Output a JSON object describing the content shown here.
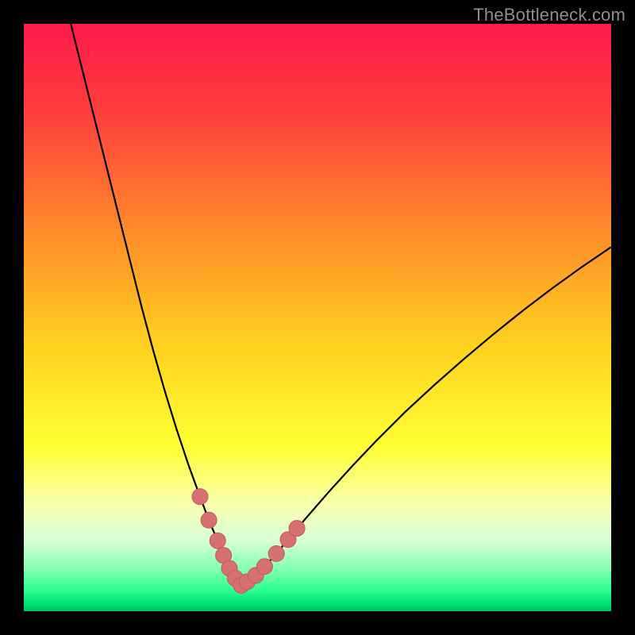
{
  "watermark": "TheBottleneck.com",
  "colors": {
    "frame": "#000000",
    "watermark": "#8f8f8f",
    "curve": "#000000",
    "marker_fill": "#d77070",
    "marker_stroke": "#c55a5a"
  },
  "chart_data": {
    "type": "line",
    "title": "",
    "xlabel": "",
    "ylabel": "",
    "xlim": [
      0,
      100
    ],
    "ylim": [
      0,
      100
    ],
    "gradient_stops": [
      {
        "offset": 0.0,
        "color": "#ff1a4b"
      },
      {
        "offset": 0.15,
        "color": "#ff3e3e"
      },
      {
        "offset": 0.35,
        "color": "#ff8a2a"
      },
      {
        "offset": 0.55,
        "color": "#ffd21f"
      },
      {
        "offset": 0.72,
        "color": "#ffff33"
      },
      {
        "offset": 0.82,
        "color": "#f7ffb0"
      },
      {
        "offset": 0.88,
        "color": "#d8ffd8"
      },
      {
        "offset": 0.93,
        "color": "#80ffb0"
      },
      {
        "offset": 0.965,
        "color": "#2bff8f"
      },
      {
        "offset": 0.985,
        "color": "#00e676"
      },
      {
        "offset": 1.0,
        "color": "#00c060"
      }
    ],
    "series": [
      {
        "name": "bottleneck-curve",
        "description": "V-shaped bottleneck/mismatch curve; two monotone branches meeting near x≈37",
        "x": [
          8,
          10,
          12,
          14,
          16,
          18,
          20,
          22,
          24,
          26,
          28,
          30,
          31.5,
          33,
          34,
          35,
          36,
          37,
          38,
          39.5,
          41,
          43,
          45,
          48,
          52,
          56,
          60,
          65,
          70,
          75,
          80,
          85,
          90,
          95,
          100
        ],
        "y": [
          100,
          92,
          84,
          76,
          68,
          60,
          52,
          44.5,
          37.5,
          31,
          25,
          19.5,
          15.5,
          12,
          9.5,
          7.3,
          5.6,
          4.4,
          5.0,
          6.1,
          7.6,
          9.8,
          12.2,
          15.8,
          20.4,
          24.8,
          29.0,
          34.0,
          38.6,
          43.0,
          47.2,
          51.2,
          55.0,
          58.6,
          62.0
        ]
      }
    ],
    "markers": {
      "name": "highlight-points",
      "description": "Clustered salmon markers near the valley/minimum of the curve",
      "points": [
        {
          "x": 30.0,
          "y": 19.5
        },
        {
          "x": 31.5,
          "y": 15.5
        },
        {
          "x": 33.0,
          "y": 12.0
        },
        {
          "x": 34.0,
          "y": 9.5
        },
        {
          "x": 35.0,
          "y": 7.3
        },
        {
          "x": 36.0,
          "y": 5.6
        },
        {
          "x": 37.0,
          "y": 4.4
        },
        {
          "x": 38.0,
          "y": 5.0
        },
        {
          "x": 39.5,
          "y": 6.1
        },
        {
          "x": 41.0,
          "y": 7.6
        },
        {
          "x": 43.0,
          "y": 9.8
        },
        {
          "x": 45.0,
          "y": 12.2
        },
        {
          "x": 46.5,
          "y": 14.1
        }
      ],
      "radius_px": 10
    }
  }
}
